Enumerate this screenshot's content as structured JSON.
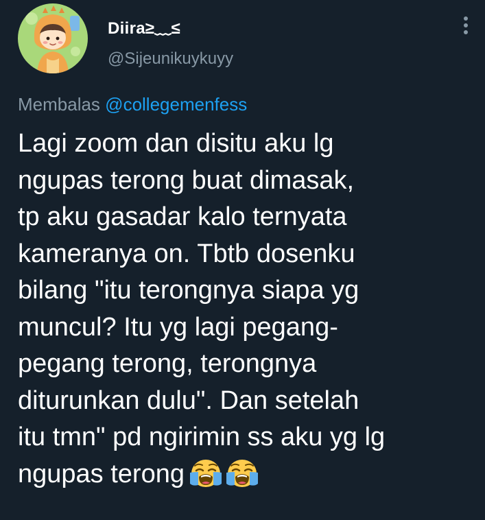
{
  "user": {
    "display_name": "Diira≥﹏≤",
    "handle": "@Sijeunikuykuyy",
    "avatar": "avatar-dino-costume-kid"
  },
  "menu": {
    "icon": "more-vertical-icon"
  },
  "reply": {
    "prefix": "Membalas",
    "mention": "@collegemenfess"
  },
  "tweet": {
    "lines": [
      "Lagi zoom dan disitu aku lg",
      "ngupas terong buat dimasak,",
      "tp aku gasadar kalo ternyata",
      "kameranya on. Tbtb dosenku",
      "bilang \"itu terongnya siapa yg",
      "muncul? Itu yg lagi pegang-",
      "pegang terong, terongnya",
      "diturunkan dulu\". Dan setelah",
      "itu tmn\" pd ngirimin ss aku yg lg",
      "ngupas terong"
    ],
    "emojis": [
      "loudly-crying-face",
      "loudly-crying-face"
    ]
  },
  "colors": {
    "background": "#15202b",
    "text": "#ffffff",
    "muted": "#8899a6",
    "link": "#1da1f2"
  }
}
